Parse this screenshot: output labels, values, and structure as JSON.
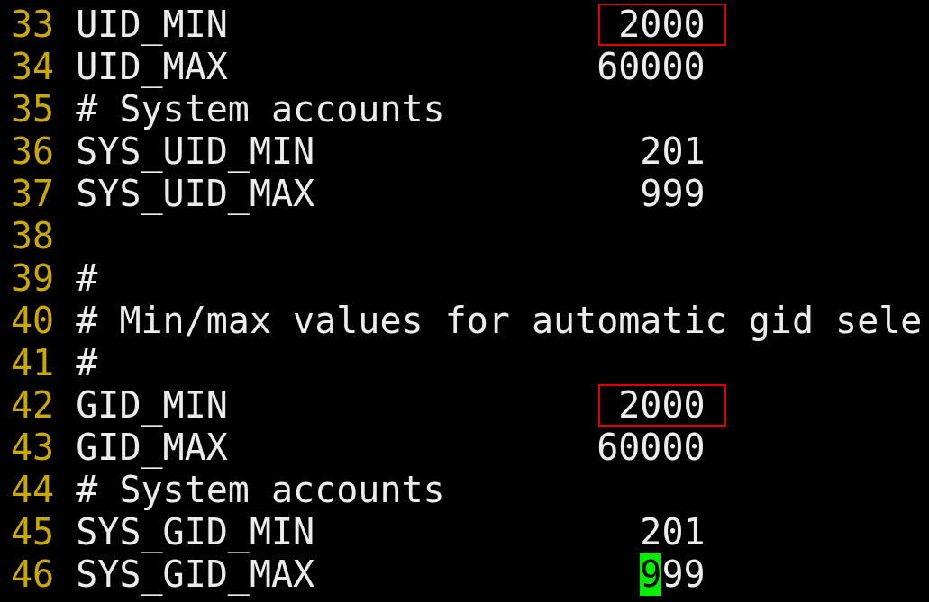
{
  "editor": {
    "lines": [
      {
        "number": "33",
        "text": "UID_MIN",
        "value": "2000",
        "boxed": true,
        "cursor": false
      },
      {
        "number": "34",
        "text": "UID_MAX",
        "value": "60000",
        "boxed": false,
        "cursor": false
      },
      {
        "number": "35",
        "text": "# System accounts"
      },
      {
        "number": "36",
        "text": "SYS_UID_MIN",
        "value": "201",
        "boxed": false,
        "cursor": false
      },
      {
        "number": "37",
        "text": "SYS_UID_MAX",
        "value": "999",
        "boxed": false,
        "cursor": false
      },
      {
        "number": "38"
      },
      {
        "number": "39",
        "text": "#"
      },
      {
        "number": "40",
        "text": "# Min/max values for automatic gid sele"
      },
      {
        "number": "41",
        "text": "#"
      },
      {
        "number": "42",
        "text": "GID_MIN",
        "value": "2000",
        "boxed": true,
        "cursor": false
      },
      {
        "number": "43",
        "text": "GID_MAX",
        "value": "60000",
        "boxed": false,
        "cursor": false
      },
      {
        "number": "44",
        "text": "# System accounts"
      },
      {
        "number": "45",
        "text": "SYS_GID_MIN",
        "value": "201",
        "boxed": false,
        "cursor": false
      },
      {
        "number": "46",
        "text": "SYS_GID_MAX",
        "value": "999",
        "boxed": false,
        "cursor": true
      }
    ]
  }
}
